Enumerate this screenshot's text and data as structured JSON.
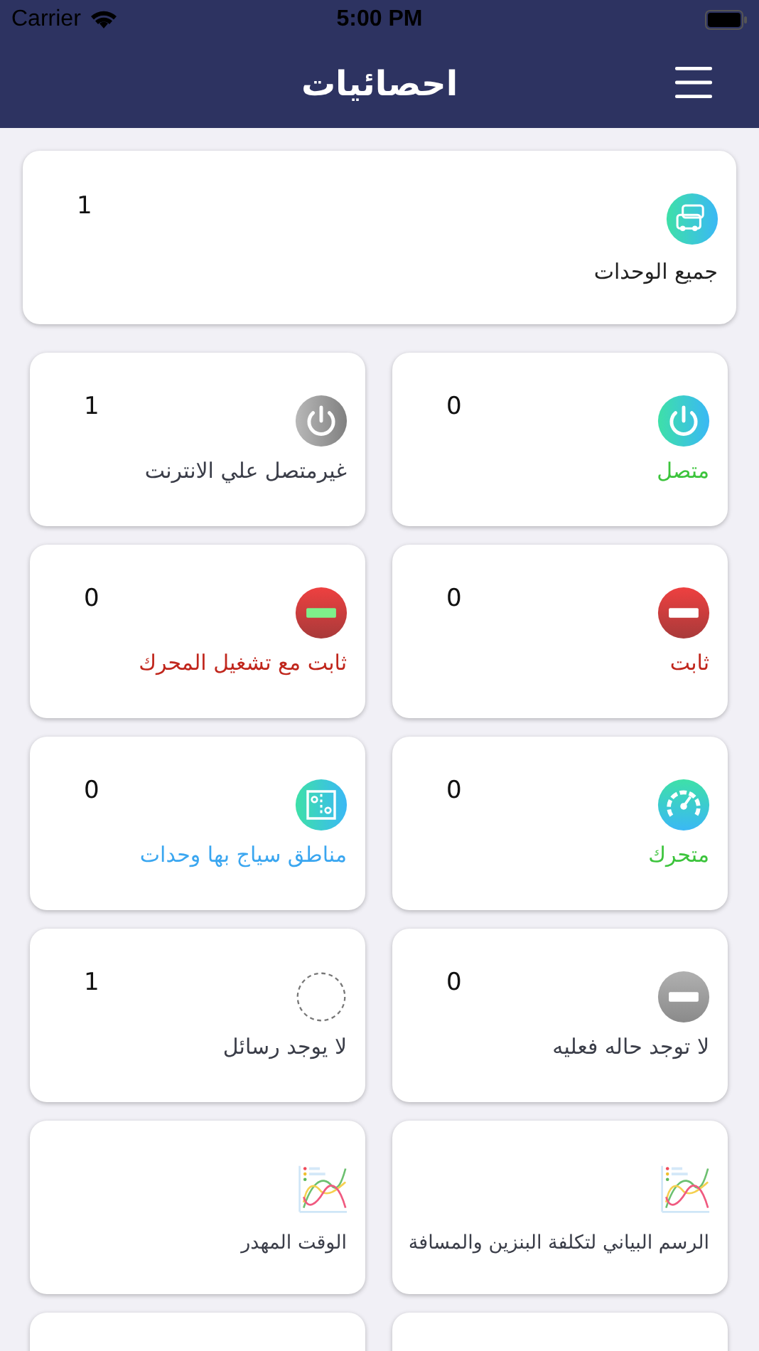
{
  "status_bar": {
    "carrier": "Carrier",
    "time": "5:00 PM"
  },
  "nav": {
    "title": "احصائيات"
  },
  "summary": {
    "label": "جميع الوحدات",
    "count": "1"
  },
  "tiles": [
    {
      "kind": "stat",
      "label": "متصل",
      "count": "0",
      "color": "#3cc43c"
    },
    {
      "kind": "stat",
      "label": "غيرمتصل علي الانترنت",
      "count": "1",
      "color": "#3a3d48"
    },
    {
      "kind": "stat",
      "label": "ثابت",
      "count": "0",
      "color": "#c0261c"
    },
    {
      "kind": "stat",
      "label": "ثابت مع تشغيل المحرك",
      "count": "0",
      "color": "#c0261c"
    },
    {
      "kind": "stat",
      "label": "متحرك",
      "count": "0",
      "color": "#3cc43c"
    },
    {
      "kind": "stat",
      "label": "مناطق سياج بها وحدات",
      "count": "0",
      "color": "#3aa6f0"
    },
    {
      "kind": "stat",
      "label": "لا توجد حاله فعليه",
      "count": "0",
      "color": "#3a3d48"
    },
    {
      "kind": "stat",
      "label": "لا يوجد رسائل",
      "count": "1",
      "color": "#3a3d48"
    },
    {
      "kind": "report",
      "label": "الرسم البياني لتكلفة البنزين والمسافة",
      "color": "#3a3d48"
    },
    {
      "kind": "report",
      "label": "الوقت المهدر",
      "color": "#3a3d48"
    },
    {
      "kind": "empty"
    },
    {
      "kind": "empty"
    }
  ]
}
